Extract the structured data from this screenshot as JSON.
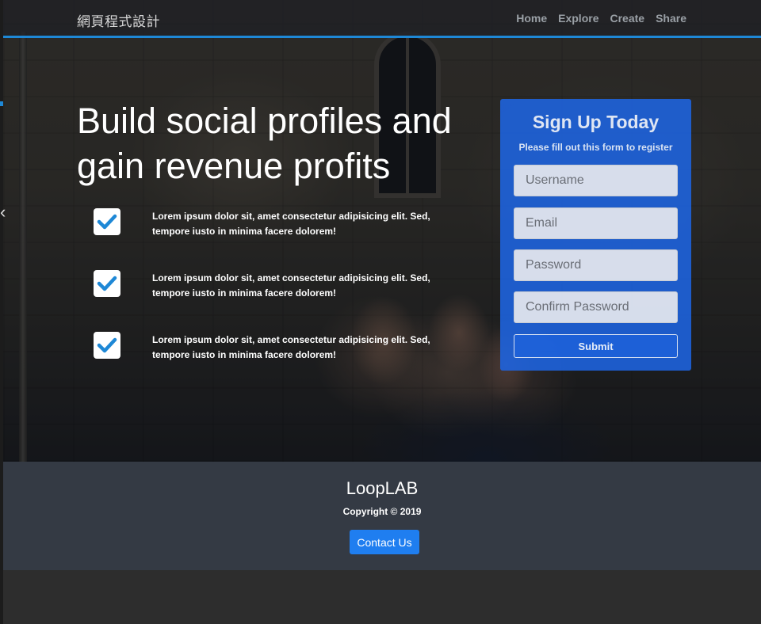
{
  "navbar": {
    "brand": "網頁程式設計",
    "links": [
      "Home",
      "Explore",
      "Create",
      "Share"
    ]
  },
  "hero": {
    "headline": "Build social profiles and gain revenue profits",
    "features": [
      {
        "icon": "check-icon",
        "text": "Lorem ipsum dolor sit, amet consectetur adipisicing elit. Sed, tempore iusto in minima facere dolorem!"
      },
      {
        "icon": "check-icon",
        "text": "Lorem ipsum dolor sit, amet consectetur adipisicing elit. Sed, tempore iusto in minima facere dolorem!"
      },
      {
        "icon": "check-icon",
        "text": "Lorem ipsum dolor sit, amet consectetur adipisicing elit. Sed, tempore iusto in minima facere dolorem!"
      }
    ]
  },
  "signup": {
    "title": "Sign Up Today",
    "subtitle": "Please fill out this form to register",
    "username_placeholder": "Username",
    "email_placeholder": "Email",
    "password_placeholder": "Password",
    "confirm_placeholder": "Confirm Password",
    "submit_label": "Submit"
  },
  "footer": {
    "brand": "LoopLAB",
    "copyright": "Copyright © 2019",
    "contact_label": "Contact Us"
  },
  "colors": {
    "accent": "#1e88d6",
    "card": "#1e64e1",
    "contact_button": "#1f7ef0",
    "footer_bg": "#343a44",
    "check": "#1e88d6"
  }
}
